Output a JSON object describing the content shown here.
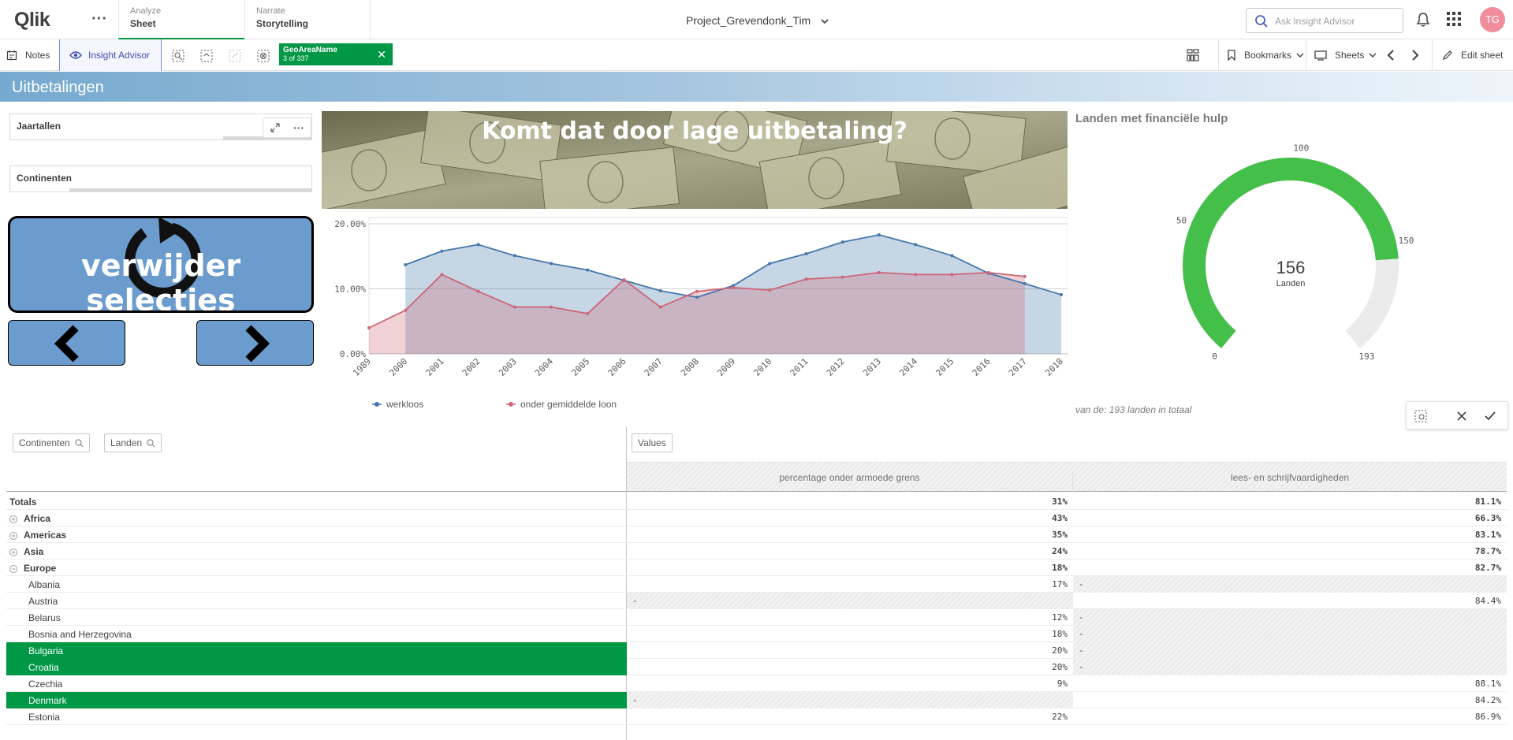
{
  "app": {
    "logo": "Qlik",
    "title": "Project_Grevendonk_Tim",
    "avatar": "TG"
  },
  "nav": {
    "tabs": [
      {
        "small": "Analyze",
        "label": "Sheet"
      },
      {
        "small": "Narrate",
        "label": "Storytelling"
      }
    ]
  },
  "search": {
    "placeholder": "Ask Insight Advisor"
  },
  "toolbar": {
    "notes": "Notes",
    "insight": "Insight Advisor",
    "bookmarks": "Bookmarks",
    "sheets": "Sheets",
    "edit": "Edit sheet"
  },
  "selection": {
    "field": "GeoAreaName",
    "count": "3 of 337"
  },
  "sheet": {
    "title": "Uitbetalingen"
  },
  "filters": [
    {
      "label": "Jaartallen"
    },
    {
      "label": "Continenten"
    }
  ],
  "reset_button": {
    "label": "verwijder selecties"
  },
  "banner": {
    "text": "Komt dat door lage uitbetaling?"
  },
  "chart_data": {
    "type": "area",
    "x": [
      "1989",
      "2000",
      "2001",
      "2002",
      "2003",
      "2004",
      "2005",
      "2006",
      "2007",
      "2008",
      "2009",
      "2010",
      "2011",
      "2012",
      "2013",
      "2014",
      "2015",
      "2016",
      "2017",
      "2018"
    ],
    "y_ticks": [
      "20.00%",
      "10.00%",
      "0.00%"
    ],
    "ylim": [
      0,
      20
    ],
    "series": [
      {
        "name": "werkloos",
        "color": "#4477aa",
        "values": [
          null,
          13.7,
          15.8,
          16.8,
          15.1,
          13.9,
          12.9,
          11.3,
          9.7,
          8.7,
          10.5,
          13.9,
          15.4,
          17.2,
          18.3,
          16.8,
          15.1,
          12.4,
          10.8,
          9.1
        ]
      },
      {
        "name": "onder gemiddelde loon",
        "color": "#cc6677",
        "values": [
          4.0,
          6.7,
          12.2,
          9.6,
          7.2,
          7.2,
          6.2,
          11.4,
          7.2,
          9.6,
          10.2,
          9.8,
          11.5,
          11.8,
          12.5,
          12.2,
          12.2,
          12.5,
          11.9,
          null
        ]
      }
    ],
    "legend": "bottom-left"
  },
  "gauge": {
    "title": "Landen met financiële hulp",
    "value": 156,
    "min": 0,
    "max": 193,
    "value_label": "156",
    "unit_label": "Landen",
    "ticks": [
      "0",
      "50",
      "100",
      "150",
      "193"
    ],
    "color": "#44c04a",
    "footnote": "van de: 193 landen in totaal"
  },
  "pivot": {
    "dim_chips": [
      "Continenten",
      "Landen"
    ],
    "value_chip": "Values",
    "columns": [
      "percentage onder armoede grens",
      "lees- en schrijfvaardigheden"
    ],
    "rows": [
      {
        "label": "Totals",
        "v1": "31%",
        "v2": "81.1%",
        "type": "total"
      },
      {
        "label": "Africa",
        "v1": "43%",
        "v2": "66.3%",
        "type": "group",
        "icon": "+"
      },
      {
        "label": "Americas",
        "v1": "35%",
        "v2": "83.1%",
        "type": "group",
        "icon": "+"
      },
      {
        "label": "Asia",
        "v1": "24%",
        "v2": "78.7%",
        "type": "group",
        "icon": "+"
      },
      {
        "label": "Europe",
        "v1": "18%",
        "v2": "82.7%",
        "type": "group",
        "icon": "−"
      },
      {
        "label": "Albania",
        "v1": "17%",
        "v2": "-",
        "type": "child",
        "h2": true
      },
      {
        "label": "Austria",
        "v1": "-",
        "v2": "84.4%",
        "type": "child",
        "h1": true
      },
      {
        "label": "Belarus",
        "v1": "12%",
        "v2": "-",
        "type": "child",
        "h2": true
      },
      {
        "label": "Bosnia and Herzegovina",
        "v1": "18%",
        "v2": "-",
        "type": "child",
        "h2": true
      },
      {
        "label": "Bulgaria",
        "v1": "20%",
        "v2": "-",
        "type": "child",
        "selected": true,
        "h2": true
      },
      {
        "label": "Croatia",
        "v1": "20%",
        "v2": "-",
        "type": "child",
        "selected": true,
        "h2": true
      },
      {
        "label": "Czechia",
        "v1": "9%",
        "v2": "88.1%",
        "type": "child"
      },
      {
        "label": "Denmark",
        "v1": "-",
        "v2": "84.2%",
        "type": "child",
        "selected": true,
        "h1": true
      },
      {
        "label": "Estonia",
        "v1": "22%",
        "v2": "86.9%",
        "type": "child"
      }
    ]
  }
}
